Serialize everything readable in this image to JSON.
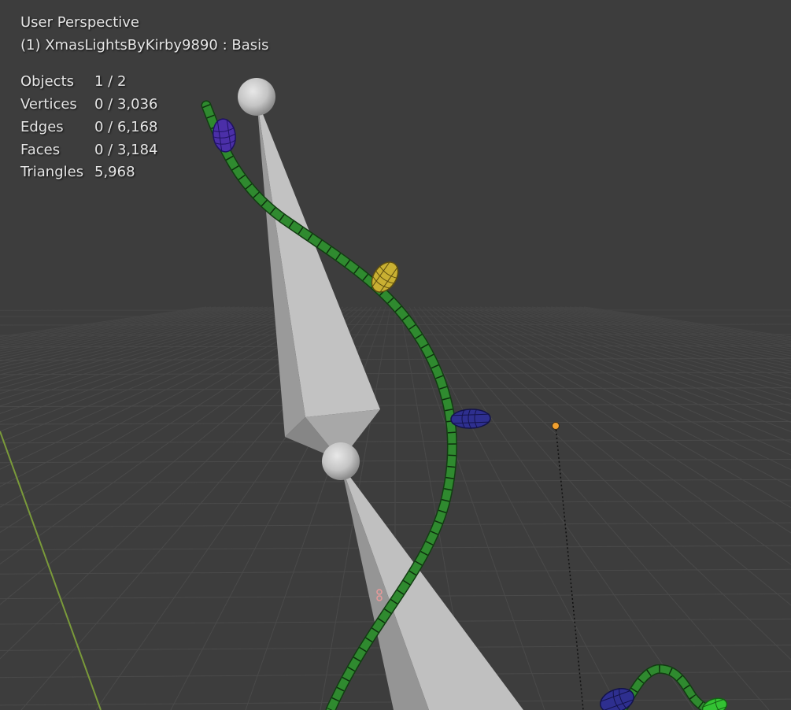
{
  "viewport": {
    "view_name": "User Perspective",
    "object_info": "(1) XmasLightsByKirby9890 : Basis"
  },
  "stats": [
    {
      "label": "Objects",
      "value": "1 / 2"
    },
    {
      "label": "Vertices",
      "value": "0 / 3,036"
    },
    {
      "label": "Edges",
      "value": "0 / 6,168"
    },
    {
      "label": "Faces",
      "value": "0 / 3,184"
    },
    {
      "label": "Triangles",
      "value": "5,968"
    }
  ],
  "colors": {
    "background": "#3d3d3d",
    "grid_line": "#4a4a4a",
    "axis_y": "#7a9a3a",
    "wire_green": "#2f8a2f",
    "bulb_purple": "#4b2fa8",
    "bulb_yellow": "#c9b032",
    "bulb_blue": "#2e2f8f",
    "bulb_green": "#33c233",
    "bone": "#b4b4b4",
    "origin": "#f0a030"
  }
}
